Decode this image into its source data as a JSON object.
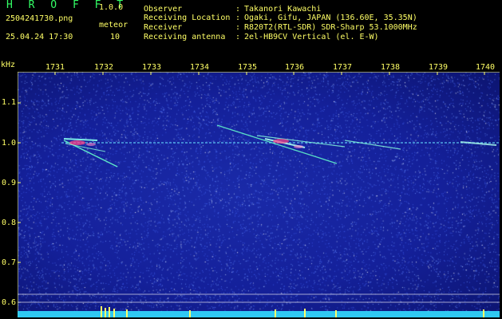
{
  "header": {
    "app_title": "H R O F F T",
    "app_version": "1.0.0",
    "filename": "2504241730.png",
    "mode": "meteor",
    "datetime": "25.04.24 17:30",
    "count": "10"
  },
  "info": [
    {
      "label": "Observer",
      "value": "Takanori Kawachi"
    },
    {
      "label": "Receiving Location",
      "value": "Ogaki, Gifu, JAPAN (136.60E, 35.35N)"
    },
    {
      "label": "Receiver",
      "value": "R820T2(RTL-SDR) SDR-Sharp 53.1000MHz"
    },
    {
      "label": "Receiving antenna",
      "value": "2el-HB9CV Vertical (el. E-W)"
    }
  ],
  "axis": {
    "y_unit": "kHz",
    "y_ticks": [
      "1.1",
      "1.0",
      "0.9",
      "0.8",
      "0.7",
      "0.6"
    ],
    "x_ticks": [
      "1731",
      "1732",
      "1733",
      "1734",
      "1735",
      "1736",
      "1737",
      "1738",
      "1739",
      "1740"
    ]
  },
  "colors": {
    "text": "#ffff66",
    "title": "#33ff66",
    "background": "#141e96",
    "carrier": "#66ddff",
    "echo": "#66ffcc",
    "hot": "#ff4488"
  }
}
